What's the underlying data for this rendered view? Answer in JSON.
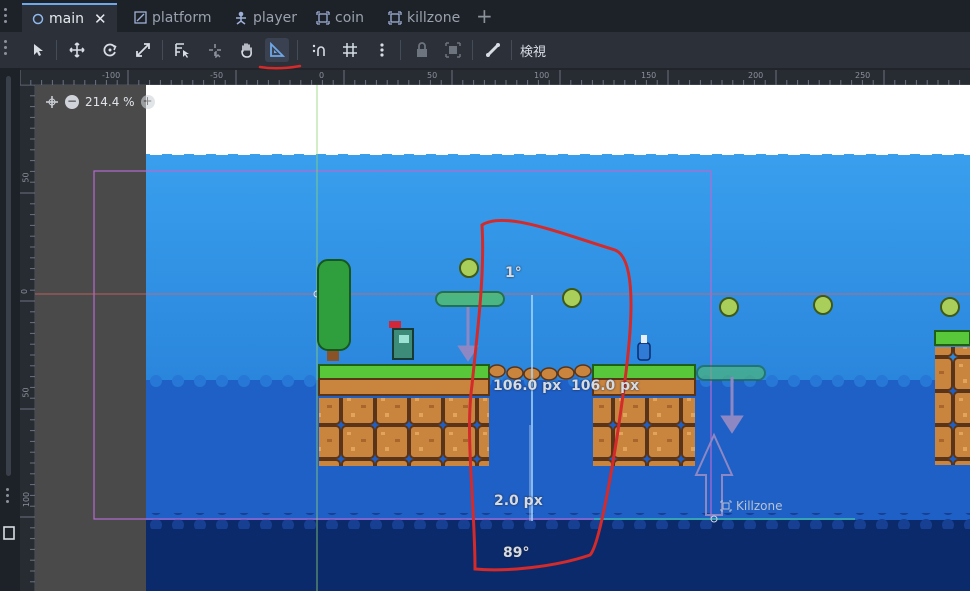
{
  "tabs": [
    {
      "label": "main",
      "icon": "node2d-icon",
      "active": true
    },
    {
      "label": "platform",
      "icon": "scene-icon",
      "active": false
    },
    {
      "label": "player",
      "icon": "character-icon",
      "active": false
    },
    {
      "label": "coin",
      "icon": "area-icon",
      "active": false
    },
    {
      "label": "killzone",
      "icon": "area-icon",
      "active": false
    }
  ],
  "toolbar": {
    "view_menu": "検視",
    "active_tool": "ruler-tool"
  },
  "ruler": {
    "top_ticks": [
      "-100",
      "-50",
      "0",
      "50",
      "100",
      "150",
      "200",
      "250"
    ],
    "left_ticks": [
      "50",
      "0",
      "50",
      "100"
    ]
  },
  "viewport": {
    "zoom": "214.4 %",
    "measure_angle_top": "1°",
    "measure_length_a": "106.0 px",
    "measure_length_b": "106.0 px",
    "measure_small": "2.0 px",
    "measure_angle_bottom": "89°",
    "killzone_label": "Killzone"
  },
  "colors": {
    "accent": "#6fa8e8",
    "sky": "#2f8fe0",
    "water_mid": "#1e5fc6",
    "water_deep": "#0b2a6b",
    "annotation": "#d42a2a"
  }
}
